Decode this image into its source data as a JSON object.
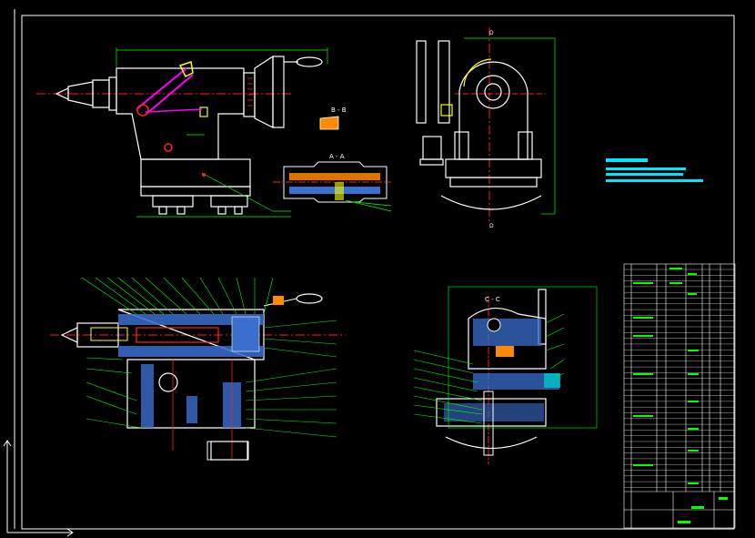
{
  "drawing": {
    "section_labels": {
      "b_b": "B - B",
      "a_a": "A - A",
      "c_c": "C - C",
      "d_top": "D",
      "d_bottom": "D"
    },
    "colors": {
      "background": "#000000",
      "frame": "#ffffff",
      "outline": "#ffffff",
      "dimension": "#00ff00",
      "centerline": "#ff2020",
      "hatch": "#ff00ff",
      "section_fill": "#3a6fd0",
      "note": "#00e6ff",
      "highlight": "#ffff00",
      "cyan_fill": "#00c8c8"
    }
  }
}
